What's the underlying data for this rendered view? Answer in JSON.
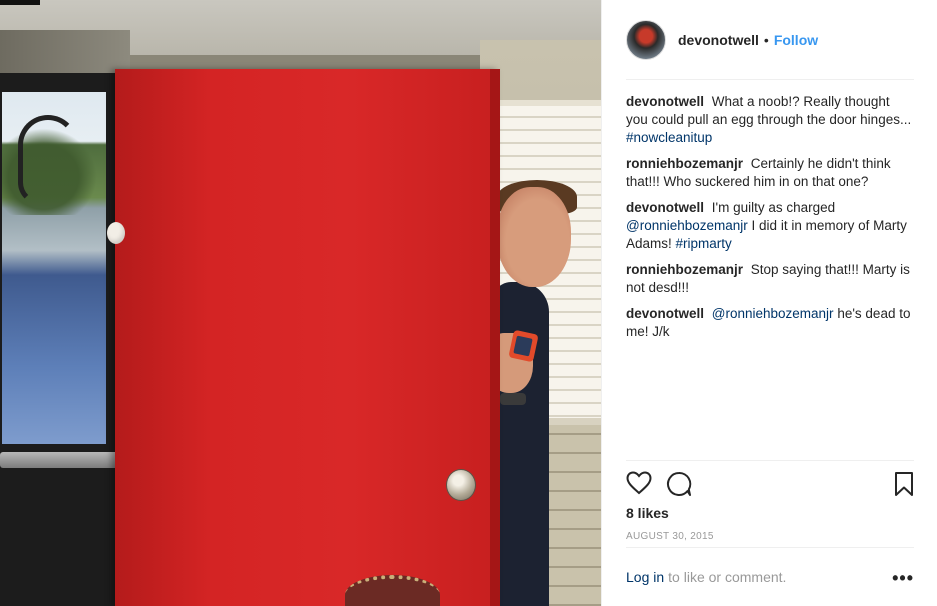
{
  "post": {
    "username": "devonotwell",
    "separator": "•",
    "follow_label": "Follow",
    "image_alt": "Man peeking from behind a red door holding a phone",
    "likes": "8 likes",
    "date": "AUGUST 30, 2015"
  },
  "comments": [
    {
      "user": "devonotwell",
      "text": "What a noob!? Really thought you could pull an egg through the door hinges...",
      "tag": "#nowcleanitup",
      "mention": ""
    },
    {
      "user": "ronniehbozemanjr",
      "text": "Certainly he didn't think that!!! Who suckered him in on that one?",
      "tag": "",
      "mention": ""
    },
    {
      "user": "devonotwell",
      "text": "I'm guilty as charged",
      "mention": "@ronniehbozemanjr",
      "text2": "I did it in memory of Marty Adams!",
      "tag": "#ripmarty"
    },
    {
      "user": "ronniehbozemanjr",
      "text": "Stop saying that!!! Marty is not desd!!!",
      "tag": "",
      "mention": ""
    },
    {
      "user": "devonotwell",
      "mention": "@ronniehbozemanjr",
      "text": "he's dead to me! J/k",
      "tag": ""
    }
  ],
  "footer": {
    "login_link": "Log in",
    "login_text": "to like or comment.",
    "more_label": "•••"
  },
  "icons": {
    "like": "heart-icon",
    "comment": "comment-bubble-icon",
    "save": "bookmark-icon",
    "more": "more-options-icon"
  },
  "colors": {
    "link": "#3897f0",
    "hashtag": "#003569",
    "door_red": "#d42424"
  }
}
